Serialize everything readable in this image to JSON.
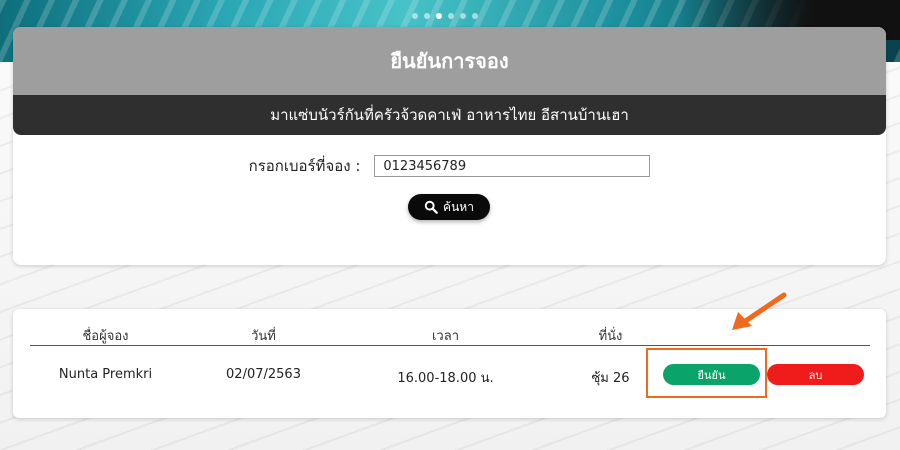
{
  "header": {
    "title": "ยืนยันการจอง",
    "subtitle": "มาแซ่บนัวร์กันที่ครัวจ้วดคาเฟ่ อาหารไทย อีสานบ้านเฮา"
  },
  "search": {
    "label": "กรอกเบอร์ที่จอง :",
    "value": "0123456789",
    "button_label": "ค้นหา"
  },
  "table": {
    "headers": [
      "ชื่อผู้จอง",
      "วันที่",
      "เวลา",
      "ที่นั่ง"
    ],
    "rows": [
      {
        "name": "Nunta Premkri",
        "date": "02/07/2563",
        "time": "16.00-18.00 น.",
        "seat": "ซุ้ม 26",
        "confirm_label": "ยืนยัน",
        "delete_label": "ลบ"
      }
    ]
  },
  "colors": {
    "confirm": "#0aa36a",
    "delete": "#f01c1c",
    "highlight": "#f06a1e"
  }
}
